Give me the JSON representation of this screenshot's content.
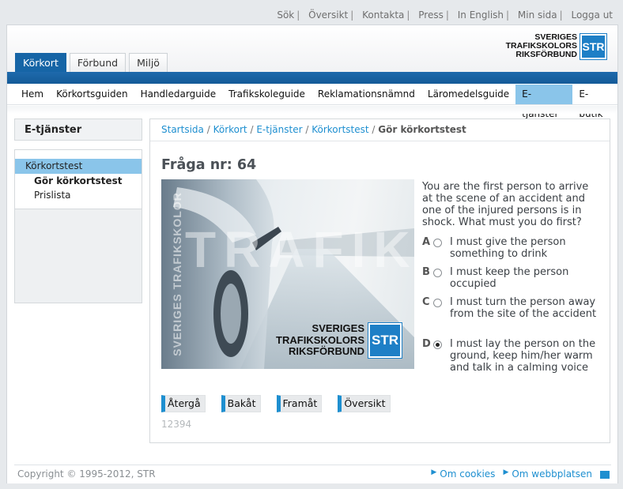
{
  "top_links": [
    "Sök",
    "Översikt",
    "Kontakta",
    "Press",
    "In English",
    "Min sida",
    "Logga ut"
  ],
  "logo": {
    "line1": "SVERIGES",
    "line2": "TRAFIKSKOLORS",
    "line3": "RIKSFÖRBUND",
    "mark": "STR"
  },
  "tabs": [
    {
      "label": "Körkort",
      "active": true
    },
    {
      "label": "Förbund",
      "active": false
    },
    {
      "label": "Miljö",
      "active": false
    }
  ],
  "nav": [
    {
      "label": "Hem"
    },
    {
      "label": "Körkortsguiden"
    },
    {
      "label": "Handledarguide"
    },
    {
      "label": "Trafikskoleguide"
    },
    {
      "label": "Reklamationsnämnd"
    },
    {
      "label": "Läromedelsguide"
    },
    {
      "label": "E-tjänster",
      "active": true
    },
    {
      "label": "E-butik"
    }
  ],
  "sidebar": {
    "title": "E-tjänster",
    "items": [
      {
        "label": "Körkortstest"
      },
      {
        "label": "Gör körkortstest"
      },
      {
        "label": "Prislista"
      }
    ]
  },
  "breadcrumb": {
    "items": [
      "Startsida",
      "Körkort",
      "E-tjänster",
      "Körkortstest"
    ],
    "current": "Gör körkortstest",
    "separator": "/"
  },
  "quiz": {
    "title": "Fråga nr: 64",
    "question": "You are the first person to arrive at the scene of an accident and one of the injured persons is in shock. What must you do first?",
    "answers": [
      {
        "letter": "A",
        "text": "I must give the person something to drink",
        "selected": false
      },
      {
        "letter": "B",
        "text": "I must keep the person occupied",
        "selected": false
      },
      {
        "letter": "C",
        "text": "I must turn the person away from the site of the accident",
        "selected": false
      },
      {
        "letter": "D",
        "text": "I must lay the person on the ground, keep him/her warm and talk in a calming voice",
        "selected": true
      }
    ],
    "image": {
      "vertical_text": "SVERIGES TRAFIKSKOLOR",
      "watermark": "TRAFIK"
    },
    "buttons": [
      "Återgå",
      "Bakåt",
      "Framåt",
      "Översikt"
    ],
    "id": "12394"
  },
  "footer": {
    "copyright": "Copyright © 1995-2012, STR",
    "links": [
      "Om cookies",
      "Om webbplatsen"
    ]
  },
  "colors": {
    "brand_blue": "#1665a6",
    "link_blue": "#1e8fd0",
    "active_nav": "#8ac5ea"
  }
}
